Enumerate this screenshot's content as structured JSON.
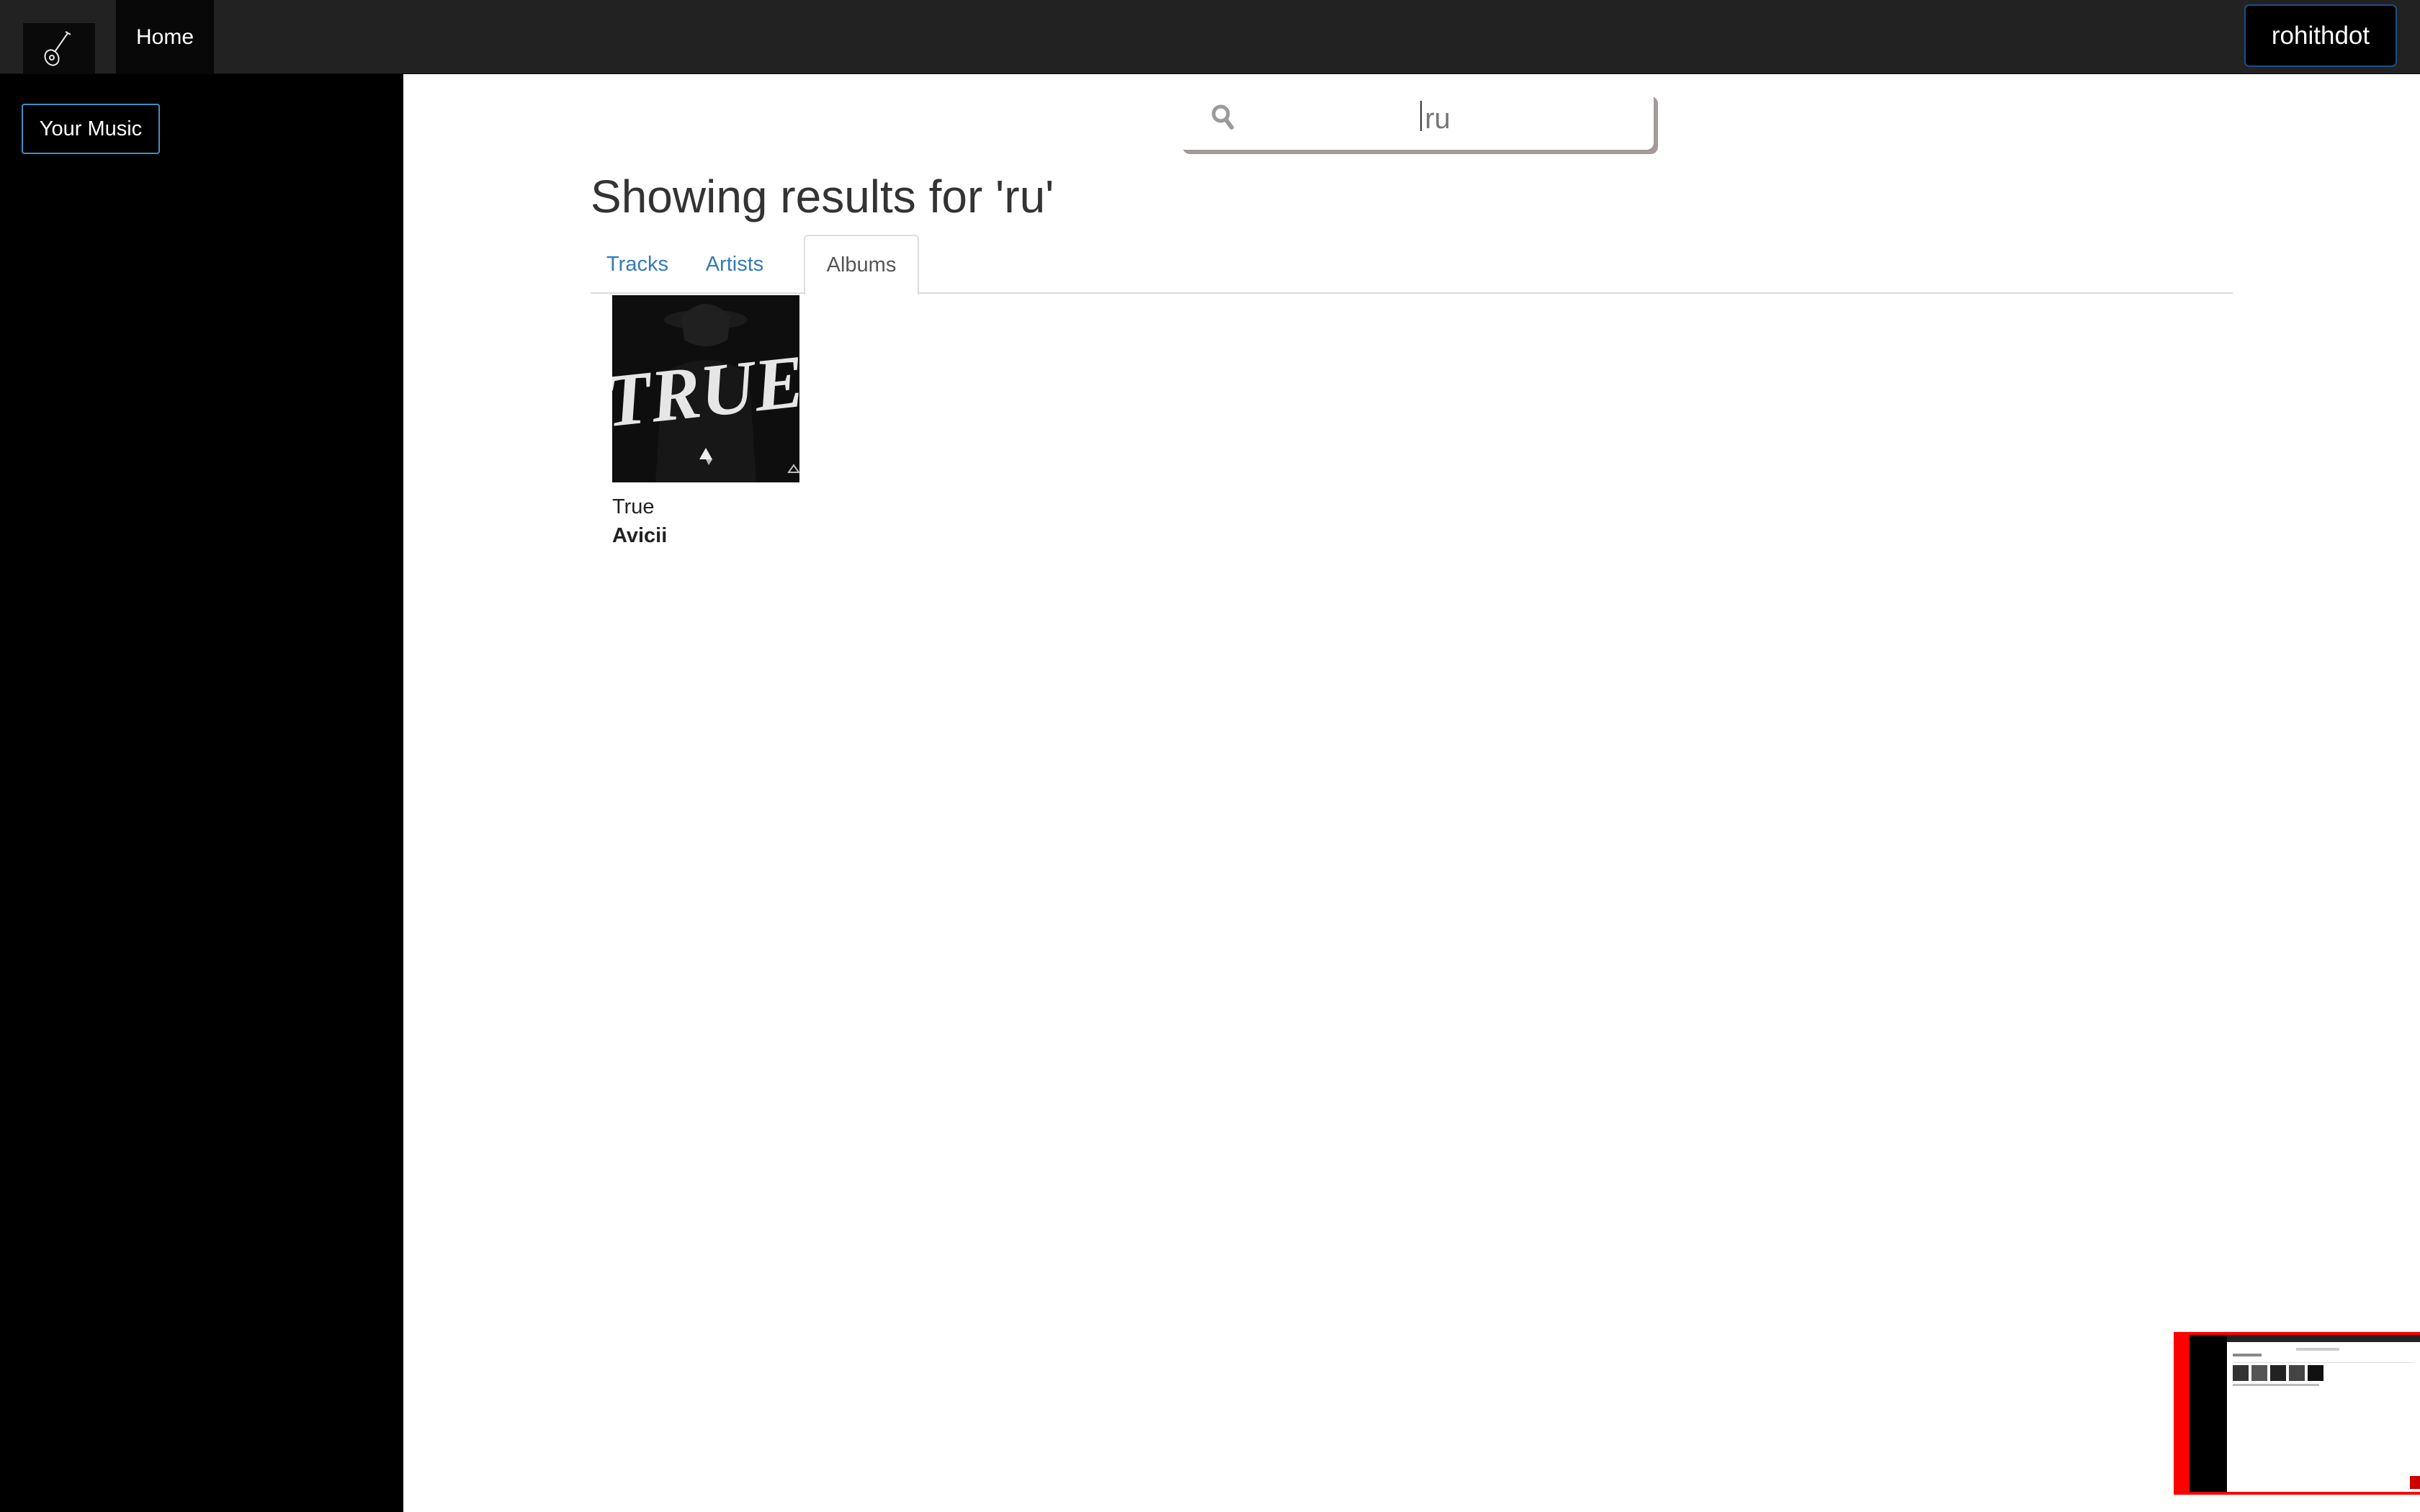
{
  "navbar": {
    "brand_icon": "guitar-logo-icon",
    "home_label": "Home",
    "user_label": "rohithdot"
  },
  "sidebar": {
    "your_music_label": "Your Music"
  },
  "search": {
    "icon": "search-icon",
    "value": "ru"
  },
  "results": {
    "heading": "Showing results for 'ru'",
    "tabs": [
      {
        "label": "Tracks",
        "active": false
      },
      {
        "label": "Artists",
        "active": false
      },
      {
        "label": "Albums",
        "active": true
      }
    ],
    "albums": [
      {
        "title": "True",
        "artist": "Avicii",
        "cover_text": "TRUE"
      }
    ]
  },
  "colors": {
    "navbar_bg": "#222222",
    "sidebar_bg": "#000000",
    "link": "#337ab7",
    "user_button_border": "#1f4e86",
    "your_music_border": "#3f8fc8",
    "thumbnail_frame": "#ff0000"
  }
}
